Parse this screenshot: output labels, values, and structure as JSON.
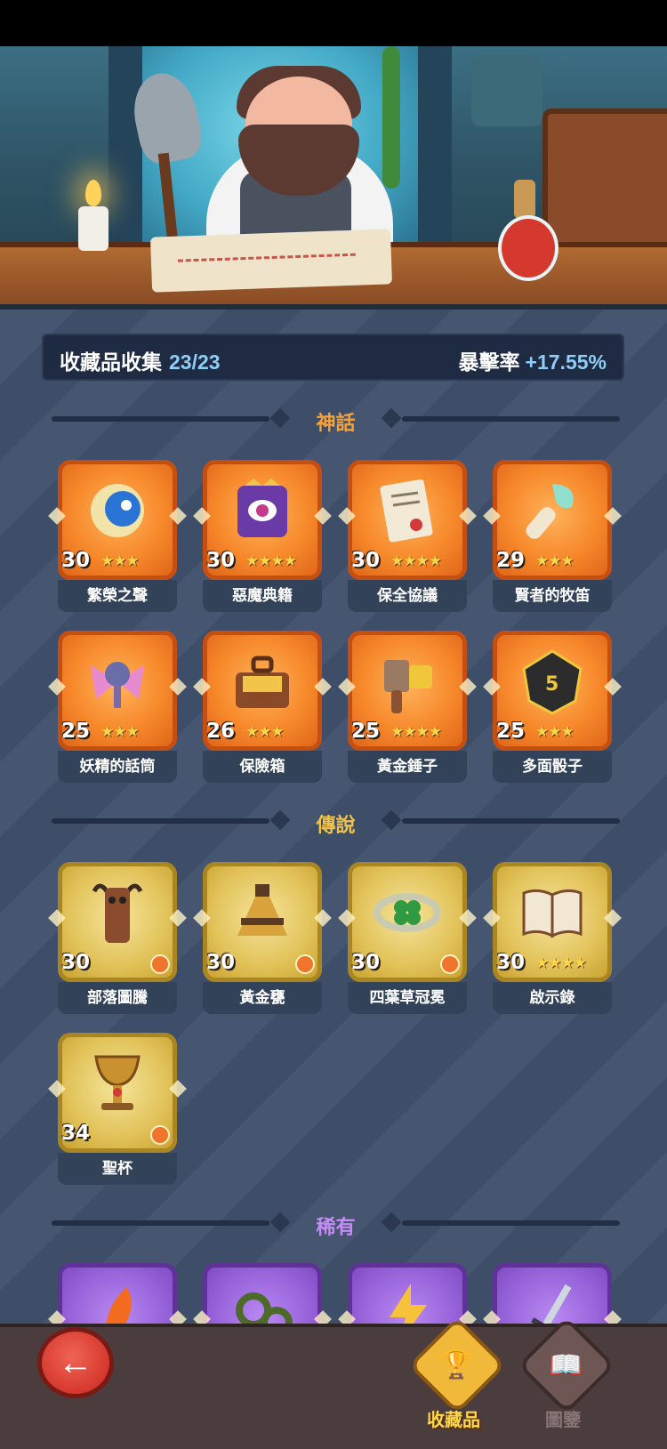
{
  "header": {
    "collection_label": "收藏品收集",
    "collection_count": "23/23",
    "crit_label": "暴擊率",
    "crit_value": "+17.55%"
  },
  "sections": {
    "mythic": {
      "title": "神話",
      "color": "#f6a23a"
    },
    "legendary": {
      "title": "傳說",
      "color": "#f0c24a"
    },
    "rare": {
      "title": "稀有",
      "color": "#c48cf6"
    }
  },
  "mythic_items": [
    {
      "level": "30",
      "stars": "★★★",
      "name": "繁榮之聲",
      "icon": "moon-spirit-icon"
    },
    {
      "level": "30",
      "stars": "★★★★",
      "name": "惡魔典籍",
      "icon": "demon-book-icon"
    },
    {
      "level": "30",
      "stars": "★★★★",
      "name": "保全協議",
      "icon": "scroll-contract-icon"
    },
    {
      "level": "29",
      "stars": "★★★",
      "name": "賢者的牧笛",
      "icon": "feather-flute-icon"
    },
    {
      "level": "25",
      "stars": "★★★",
      "name": "妖精的話筒",
      "icon": "fairy-microphone-icon"
    },
    {
      "level": "26",
      "stars": "★★★",
      "name": "保險箱",
      "icon": "treasure-chest-icon"
    },
    {
      "level": "25",
      "stars": "★★★★",
      "name": "黃金錘子",
      "icon": "golden-hammer-icon"
    },
    {
      "level": "25",
      "stars": "★★★",
      "name": "多面骰子",
      "icon": "dice-icon"
    }
  ],
  "legendary_items": [
    {
      "level": "30",
      "stars": "",
      "name": "部落圖騰",
      "icon": "totem-icon"
    },
    {
      "level": "30",
      "stars": "",
      "name": "黃金甕",
      "icon": "golden-urn-icon"
    },
    {
      "level": "30",
      "stars": "",
      "name": "四葉草冠冕",
      "icon": "clover-crown-icon"
    },
    {
      "level": "30",
      "stars": "★★★★",
      "name": "啟示錄",
      "icon": "open-book-icon"
    },
    {
      "level": "34",
      "stars": "",
      "name": "聖杯",
      "icon": "chalice-icon"
    }
  ],
  "rare_items": [
    {
      "icon": "fire-feather-icon"
    },
    {
      "icon": "vine-ring-icon"
    },
    {
      "icon": "lightning-crystal-icon"
    },
    {
      "icon": "sword-icon"
    }
  ],
  "nav": {
    "collection_tab": "收藏品",
    "encyclopedia_tab": "圖鑒"
  }
}
